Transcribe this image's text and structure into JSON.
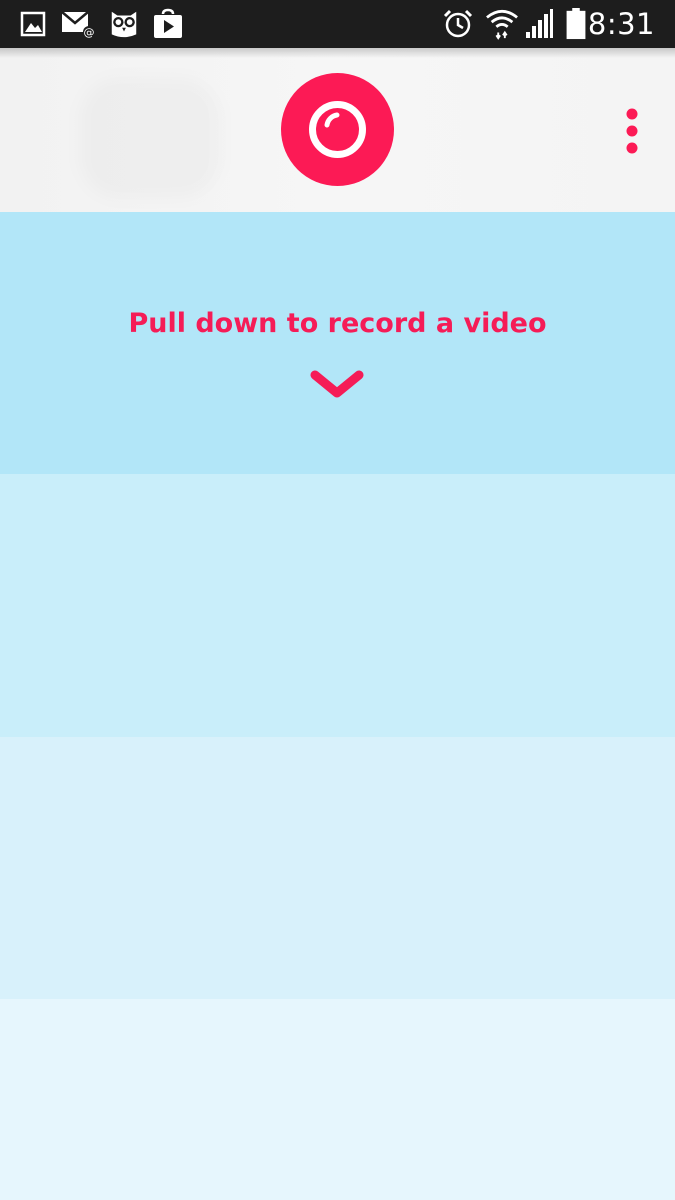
{
  "status_bar": {
    "time": "8:31",
    "icons": [
      "gallery-icon",
      "email-icon",
      "hootsuite-owl-icon",
      "play-store-icon",
      "alarm-icon",
      "wifi-icon",
      "signal-icon",
      "battery-icon"
    ]
  },
  "header": {
    "record_button": "record-video-button",
    "menu": "overflow-menu-icon"
  },
  "pull_prompt": {
    "text": "Pull down to record a video",
    "icon": "chevron-down-icon"
  },
  "colors": {
    "accent": "#fc1a55",
    "status_bar": "#1d1d1d",
    "header_bg": "#f4f4f4",
    "band_1": "#b2e6f8",
    "band_2": "#c9eefa",
    "band_3": "#d8f1fb",
    "band_4": "#e6f6fd"
  }
}
